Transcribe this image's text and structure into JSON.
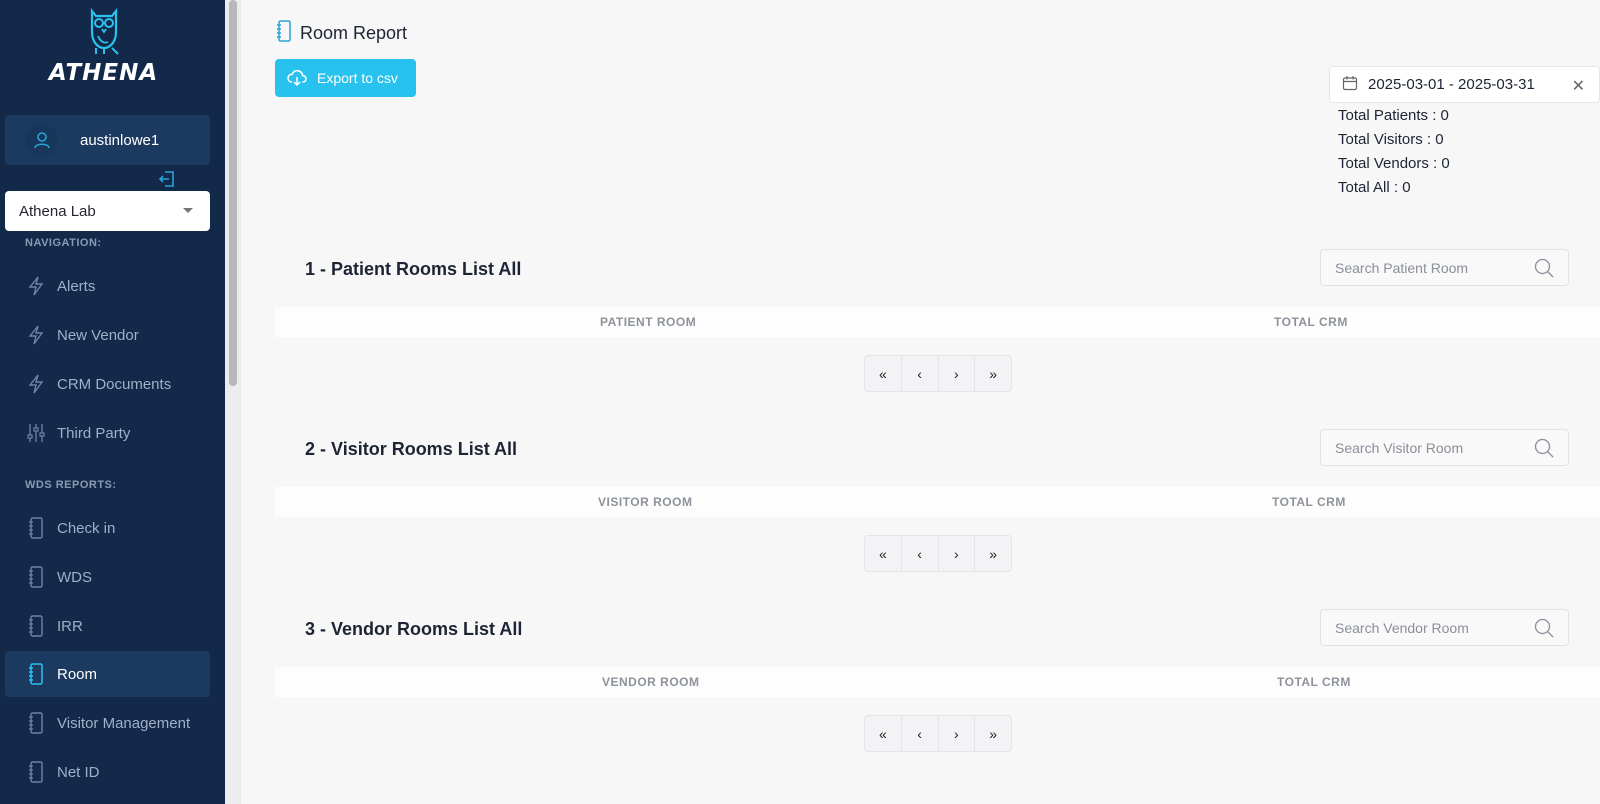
{
  "app": {
    "name": "ATHENA"
  },
  "user": {
    "name": "austinlowe1"
  },
  "lab_select": {
    "value": "Athena Lab"
  },
  "navigation": {
    "heading": "NAVIGATION:",
    "items": [
      {
        "label": "Alerts",
        "icon": "lightning-icon"
      },
      {
        "label": "New Vendor",
        "icon": "lightning-icon"
      },
      {
        "label": "CRM Documents",
        "icon": "lightning-icon"
      },
      {
        "label": "Third Party",
        "icon": "sliders-icon"
      }
    ]
  },
  "wds_reports": {
    "heading": "WDS REPORTS:",
    "items": [
      {
        "label": "Check in",
        "icon": "notebook-icon"
      },
      {
        "label": "WDS",
        "icon": "notebook-icon"
      },
      {
        "label": "IRR",
        "icon": "notebook-icon"
      },
      {
        "label": "Room",
        "icon": "notebook-icon",
        "active": true
      },
      {
        "label": "Visitor Management",
        "icon": "notebook-icon"
      },
      {
        "label": "Net ID",
        "icon": "notebook-icon"
      }
    ]
  },
  "page": {
    "title": "Room Report",
    "export_label": "Export to csv",
    "date_range": "2025-03-01 - 2025-03-31",
    "totals": [
      "Total Patients : 0",
      "Total Visitors : 0",
      "Total Vendors : 0",
      "Total All : 0"
    ]
  },
  "sections": [
    {
      "title": "1 - Patient Rooms List All",
      "search_placeholder": "Search Patient Room",
      "col1": "PATIENT ROOM",
      "col2": "TOTAL CRM"
    },
    {
      "title": "2 - Visitor Rooms List All",
      "search_placeholder": "Search Visitor Room",
      "col1": "VISITOR ROOM",
      "col2": "TOTAL CRM"
    },
    {
      "title": "3 - Vendor Rooms List All",
      "search_placeholder": "Search Vendor Room",
      "col1": "VENDOR ROOM",
      "col2": "TOTAL CRM"
    }
  ],
  "pager": {
    "first": "«",
    "prev": "‹",
    "next": "›",
    "last": "»"
  },
  "colors": {
    "sidebar": "#13294a",
    "accent": "#29c2ee",
    "active_item": "#1c3a60"
  }
}
